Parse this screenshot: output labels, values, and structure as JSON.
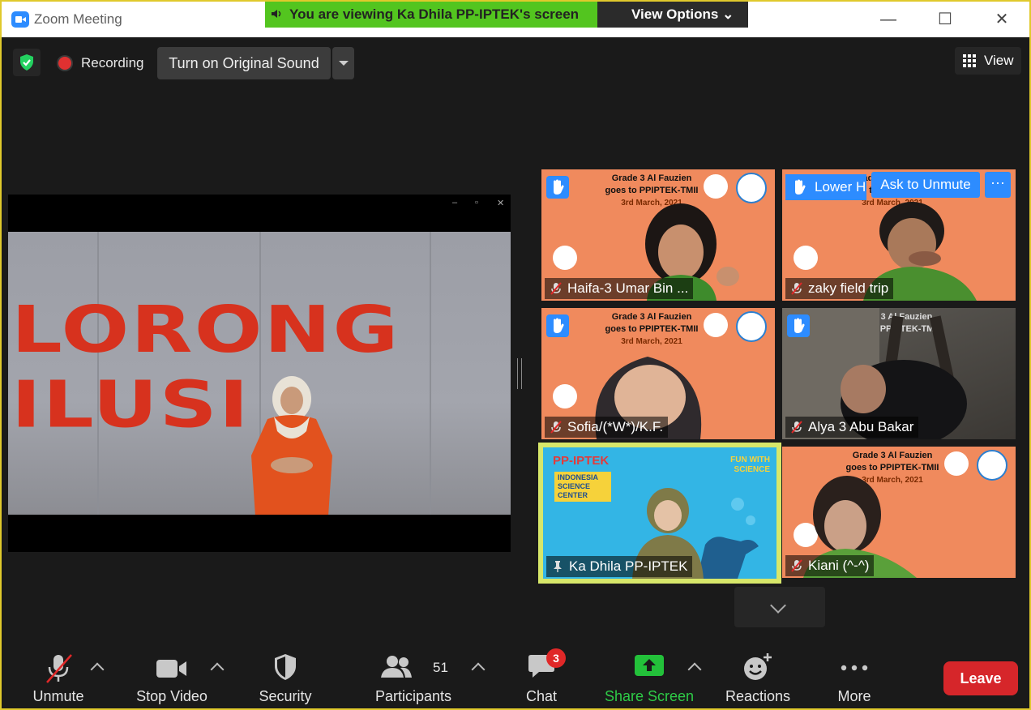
{
  "window": {
    "title": "Zoom Meeting"
  },
  "banner": {
    "viewing_text": "You are viewing Ka Dhila PP-IPTEK's screen",
    "view_options": "View Options"
  },
  "topbar": {
    "recording_label": "Recording",
    "original_sound": "Turn on Original Sound",
    "view_label": "View"
  },
  "share": {
    "logo_text": "LORONG ILUSI"
  },
  "tile_header": {
    "line1": "Grade 3 Al Fauzien",
    "line2": "goes to PPIPTEK-TMII",
    "date": "3rd March, 2021"
  },
  "participants": [
    {
      "name": "Haifa-3 Umar Bin ..."
    },
    {
      "name": "zaky field trip",
      "lower_hand": "Lower Hand",
      "ask_unmute": "Ask to Unmute",
      "more": "···"
    },
    {
      "name": "Sofia/(*W*)/K.F."
    },
    {
      "name": "Alya 3 Abu Bakar"
    },
    {
      "name": "Ka Dhila PP-IPTEK",
      "logo": "PP-IPTEK",
      "sign": "INDONESIA SCIENCE CENTER",
      "fun": "FUN WITH SCIENCE"
    },
    {
      "name": "Kiani (^-^)"
    }
  ],
  "toolbar": {
    "unmute": "Unmute",
    "stop_video": "Stop Video",
    "security": "Security",
    "participants": "Participants",
    "participants_count": "51",
    "chat": "Chat",
    "chat_badge": "3",
    "share_screen": "Share Screen",
    "reactions": "Reactions",
    "more": "More",
    "leave": "Leave"
  },
  "colors": {
    "accent_blue": "#2d8cff",
    "share_green": "#53c51f",
    "leave_red": "#d6262a",
    "tile_orange": "#f08a5d",
    "frame_yellow": "#e0c92c"
  }
}
